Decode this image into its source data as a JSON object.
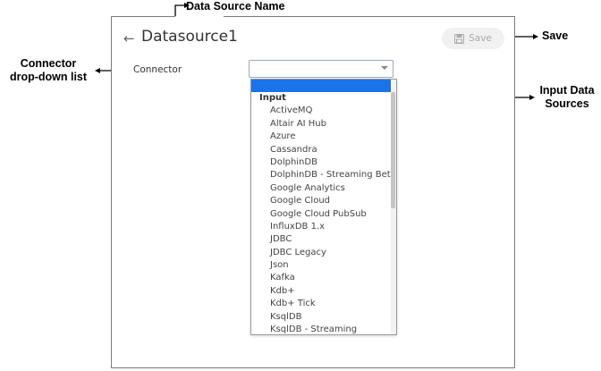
{
  "annotations": {
    "data_source_name": "Data Source Name",
    "save": "Save",
    "connector_line1": "Connector",
    "connector_line2": "drop-down list",
    "input_line1": "Input Data",
    "input_line2": "Sources"
  },
  "header": {
    "title": "Datasource1",
    "save_label": "Save"
  },
  "form": {
    "connector_label": "Connector",
    "connector_value": ""
  },
  "dropdown": {
    "group_label": "Input",
    "items": [
      "ActiveMQ",
      "Altair AI Hub",
      "Azure",
      "Cassandra",
      "DolphinDB",
      "DolphinDB - Streaming Beta",
      "Google Analytics",
      "Google Cloud",
      "Google Cloud PubSub",
      "InfluxDB 1.x",
      "JDBC",
      "JDBC Legacy",
      "Json",
      "Kafka",
      "Kdb+",
      "Kdb+ Tick",
      "KsqlDB",
      "KsqlDB - Streaming"
    ]
  },
  "colors": {
    "highlight": "#1a73e8",
    "save_bg": "#f1f1f1",
    "frame_border": "#7a7a7a"
  },
  "icons": {
    "back": "arrow-left-icon",
    "save": "floppy-disk-icon",
    "caret": "chevron-down-icon"
  }
}
